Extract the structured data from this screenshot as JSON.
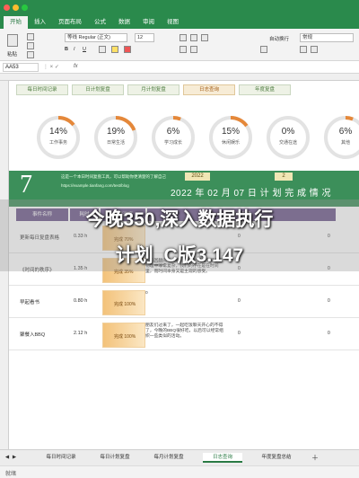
{
  "ribbon": {
    "tabs": [
      "开始",
      "插入",
      "页面布局",
      "公式",
      "数据",
      "审阅",
      "视图"
    ],
    "font_name": "等线 Regular (正文)",
    "font_size": "12",
    "wrap_label": "自动换行",
    "number_format": "常规",
    "paste_label": "粘贴"
  },
  "formula_bar": {
    "cell_ref": "AA53",
    "fx": "fx"
  },
  "nav": [
    "每日时间记录",
    "日计划复盘",
    "月计划复盘",
    "日志查询",
    "年度复盘"
  ],
  "rings": [
    {
      "pct": "14%",
      "label": "工作事务",
      "value": 0.14,
      "color": "#e5883a"
    },
    {
      "pct": "19%",
      "label": "日常生活",
      "value": 0.19,
      "color": "#e5883a"
    },
    {
      "pct": "6%",
      "label": "学习成长",
      "value": 0.06,
      "color": "#e5883a"
    },
    {
      "pct": "15%",
      "label": "休闲娱乐",
      "value": 0.15,
      "color": "#e5883a"
    },
    {
      "pct": "0%",
      "label": "交通在途",
      "value": 0.0,
      "color": "#e5883a"
    },
    {
      "pct": "6%",
      "label": "其他",
      "value": 0.06,
      "color": "#e5883a"
    }
  ],
  "band": {
    "day": "7",
    "sub": "这是一个本日时间复盘工具，可以帮助你更清楚的了解自己",
    "url": "https://example.tianfang.com/test/blog",
    "title": "2022 年 02 月 07 日 计 划 完 成 情 况",
    "year": "2022",
    "month": "2"
  },
  "table": {
    "headers": [
      "事件名称",
      "耗时",
      "完成进度",
      "事件复盘"
    ],
    "rows": [
      {
        "name": "更新每日复盘表格",
        "hours": "0.33 h",
        "prog": "完成 70%",
        "desc": "",
        "z1": "0",
        "z2": "0"
      },
      {
        "name": "《时间的秩序》",
        "hours": "1.35 h",
        "prog": "完成 35%",
        "desc": "我来回翻阅了一遍，觉得时间这个概念在物理中非常复杂，我们的存在是在时间里，而时间本身又是主观的感受。",
        "z1": "0",
        "z2": "0"
      },
      {
        "name": "早起看书",
        "hours": "0.80 h",
        "prog": "完成 100%",
        "desc": "0",
        "z1": "0",
        "z2": "0"
      },
      {
        "name": "聚餐入BBQ",
        "hours": "2.12 h",
        "prog": "完成 100%",
        "desc": "朋友们过来了，一起吃饭聊天开心的不得了，今晚的BBQ很好吃，以后可以经常组织一些类似的活动。",
        "z1": "0",
        "z2": "0"
      }
    ]
  },
  "overlay": {
    "line1": "今晚350,深入数据执行",
    "line2": "计划_C版3.147"
  },
  "sheet_tabs": [
    "每日时间记录",
    "每日计划复盘",
    "每月计划复盘",
    "日志查询",
    "年度复盘总结"
  ],
  "status": "就绪"
}
